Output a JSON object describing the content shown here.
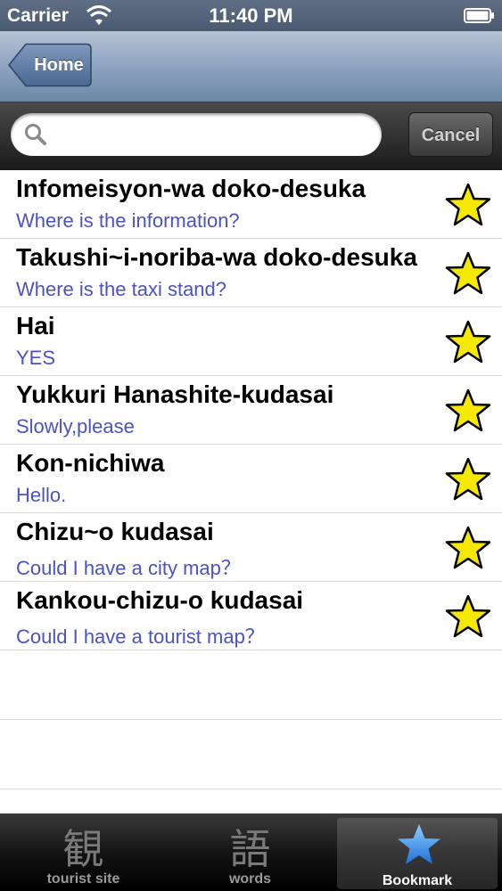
{
  "status_bar": {
    "carrier": "Carrier",
    "time": "11:40 PM",
    "icons": [
      "wifi-icon",
      "battery-icon"
    ]
  },
  "nav_bar": {
    "back_label": "Home"
  },
  "search": {
    "value": "",
    "placeholder": "",
    "cancel_label": "Cancel"
  },
  "list": {
    "items": [
      {
        "title": "Infomeisyon-wa doko-desuka",
        "subtitle": "Where is the information?",
        "icon": "star-icon"
      },
      {
        "title": "Takushi~i-noriba-wa doko-desuka",
        "subtitle": "Where is the taxi stand?",
        "icon": "star-icon"
      },
      {
        "title": "Hai",
        "subtitle": "YES",
        "icon": "star-icon"
      },
      {
        "title": "Yukkuri Hanashite-kudasai",
        "subtitle": "Slowly,please",
        "icon": "star-icon"
      },
      {
        "title": "Kon-nichiwa",
        "subtitle": "Hello.",
        "icon": "star-icon"
      },
      {
        "title": "Chizu~o kudasai",
        "subtitle": "Could I have a city map？",
        "icon": "star-icon"
      },
      {
        "title": "Kankou-chizu-o kudasai",
        "subtitle": "Could I have a tourist map？",
        "icon": "star-icon"
      }
    ]
  },
  "tab_bar": {
    "tabs": [
      {
        "glyph": "観",
        "label": "tourist site",
        "selected": false
      },
      {
        "glyph": "語",
        "label": "words",
        "selected": false
      },
      {
        "glyph": "",
        "label": "Bookmark",
        "selected": true,
        "icon": "star-icon"
      }
    ]
  },
  "colors": {
    "subtitle": "#4a52c4",
    "star_fill": "#f7e800",
    "tab_selected_star": "#3a8ee8"
  }
}
